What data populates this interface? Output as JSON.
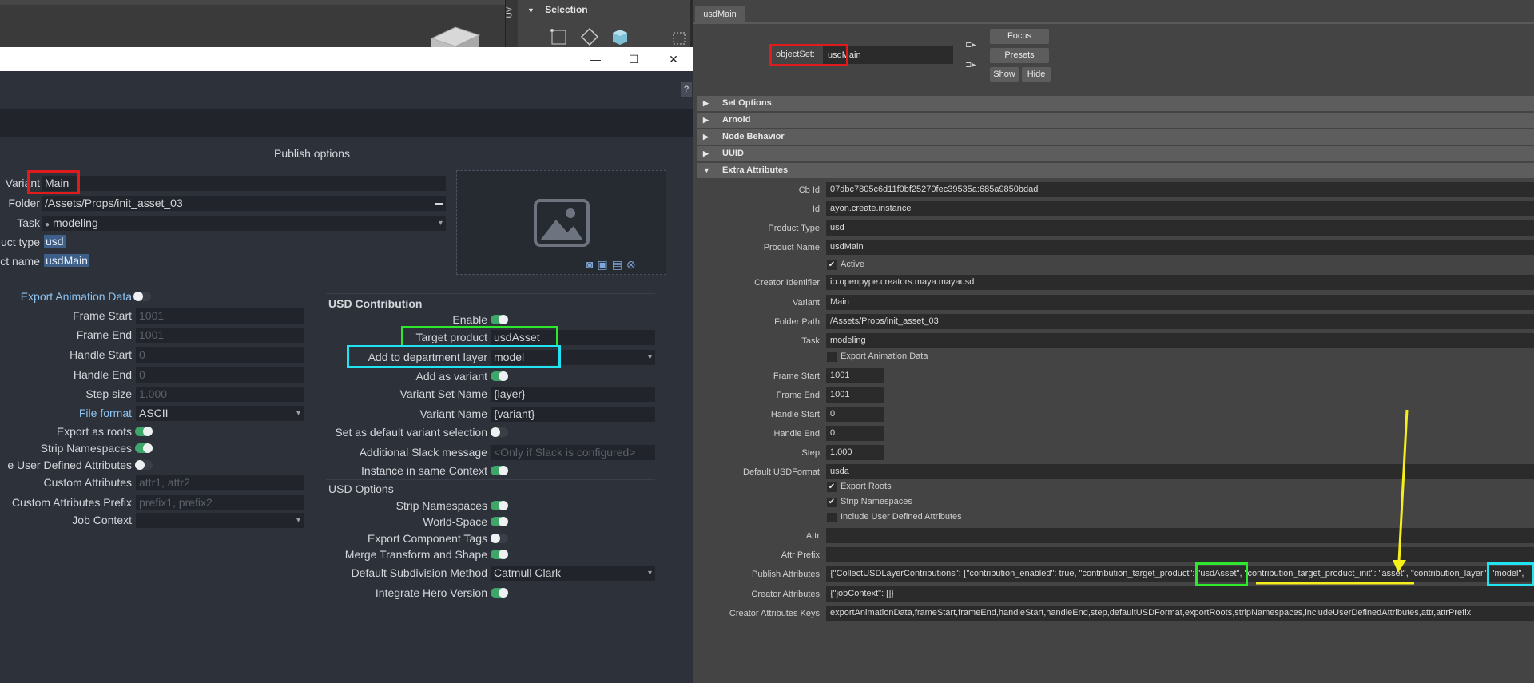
{
  "colors": {
    "red_box": "#e01b1b",
    "green_box": "#2ee82e",
    "cyan_box": "#22e3f2",
    "yellow_arrow": "#f5ef1b",
    "toggle_on": "#3fa66a",
    "publisher_bg": "#2c313a",
    "attribute_editor_bg": "#444444"
  },
  "maya": {
    "uv_label": "UV",
    "selection_header": "Selection"
  },
  "window_controls": {
    "minimize": "—",
    "maximize": "☐",
    "close": "✕"
  },
  "publisher": {
    "help": "?",
    "publish_options_title": "Publish options",
    "product": {
      "variant_label": "Variant",
      "variant_value": "Main",
      "folder_label": "Folder",
      "folder_value": "/Assets/Props/init_asset_03",
      "task_label": "Task",
      "task_value": "modeling",
      "product_type_label": "uct type",
      "product_type_value": "usd",
      "product_name_label": "ct name",
      "product_name_value": "usdMain"
    },
    "left": {
      "export_animation_label": "Export Animation Data",
      "frame_start_label": "Frame Start",
      "frame_start_value": "1001",
      "frame_end_label": "Frame End",
      "frame_end_value": "1001",
      "handle_start_label": "Handle Start",
      "handle_start_value": "0",
      "handle_end_label": "Handle End",
      "handle_end_value": "0",
      "step_size_label": "Step size",
      "step_size_value": "1.000",
      "file_format_label": "File format",
      "file_format_value": "ASCII",
      "export_as_roots_label": "Export as roots",
      "strip_namespaces_label": "Strip Namespaces",
      "include_user_defined_label": "e User Defined Attributes",
      "custom_attributes_label": "Custom Attributes",
      "custom_attributes_placeholder": "attr1, attr2",
      "custom_attributes_prefix_label": "Custom Attributes Prefix",
      "custom_attributes_prefix_placeholder": "prefix1, prefix2",
      "job_context_label": "Job Context"
    },
    "usd_contribution": {
      "title": "USD Contribution",
      "enable_label": "Enable",
      "target_product_label": "Target product",
      "target_product_value": "usdAsset",
      "department_layer_label": "Add to department layer",
      "department_layer_value": "model",
      "add_as_variant_label": "Add as variant",
      "variant_set_name_label": "Variant Set Name",
      "variant_set_name_value": "{layer}",
      "variant_name_label": "Variant Name",
      "variant_name_value": "{variant}",
      "default_variant_label": "Set as default variant selection",
      "slack_label": "Additional Slack message",
      "slack_placeholder": "<Only if Slack is configured>",
      "same_context_label": "Instance in same Context"
    },
    "usd_options": {
      "title": "USD Options",
      "strip_namespaces_label": "Strip Namespaces",
      "world_space_label": "World-Space",
      "export_component_tags_label": "Export Component Tags",
      "merge_transform_label": "Merge Transform and Shape",
      "subdivision_label": "Default Subdivision Method",
      "subdivision_value": "Catmull Clark",
      "integrate_hero_label": "Integrate Hero Version"
    }
  },
  "attribute_editor": {
    "tab": "usdMain",
    "objectset_label": "objectSet:",
    "objectset_value": "usdMain",
    "focus": "Focus",
    "presets": "Presets",
    "show": "Show",
    "hide": "Hide",
    "sections": {
      "set_options": "Set Options",
      "arnold": "Arnold",
      "node_behavior": "Node Behavior",
      "uuid": "UUID",
      "extra_attributes": "Extra Attributes"
    },
    "extra": {
      "cb_id_label": "Cb Id",
      "cb_id_value": "07dbc7805c6d11f0bf25270fec39535a:685a9850bdad",
      "id_label": "Id",
      "id_value": "ayon.create.instance",
      "product_type_label": "Product Type",
      "product_type_value": "usd",
      "product_name_label": "Product Name",
      "product_name_value": "usdMain",
      "active_label": "Active",
      "creator_identifier_label": "Creator Identifier",
      "creator_identifier_value": "io.openpype.creators.maya.mayausd",
      "variant_label": "Variant",
      "variant_value": "Main",
      "folder_path_label": "Folder Path",
      "folder_path_value": "/Assets/Props/init_asset_03",
      "task_label": "Task",
      "task_value": "modeling",
      "export_animation_label": "Export Animation Data",
      "frame_start_label": "Frame Start",
      "frame_start_value": "1001",
      "frame_end_label": "Frame End",
      "frame_end_value": "1001",
      "handle_start_label": "Handle Start",
      "handle_start_value": "0",
      "handle_end_label": "Handle End",
      "handle_end_value": "0",
      "step_label": "Step",
      "step_value": "1.000",
      "default_usdformat_label": "Default USDFormat",
      "default_usdformat_value": "usda",
      "export_roots_label": "Export Roots",
      "strip_namespaces_label": "Strip Namespaces",
      "include_user_defined_label": "Include User Defined Attributes",
      "attr_label": "Attr",
      "attr_prefix_label": "Attr Prefix",
      "publish_attributes_label": "Publish Attributes",
      "publish_attributes_value": "{\"CollectUSDLayerContributions\": {\"contribution_enabled\": true, \"contribution_target_product\": \"usdAsset\", \"contribution_target_product_init\": \"asset\", \"contribution_layer\": \"model\", ",
      "creator_attributes_label": "Creator Attributes",
      "creator_attributes_value": "{\"jobContext\": []}",
      "creator_attributes_keys_label": "Creator Attributes Keys",
      "creator_attributes_keys_value": "exportAnimationData,frameStart,frameEnd,handleStart,handleEnd,step,defaultUSDFormat,exportRoots,stripNamespaces,includeUserDefinedAttributes,attr,attrPrefix"
    }
  }
}
